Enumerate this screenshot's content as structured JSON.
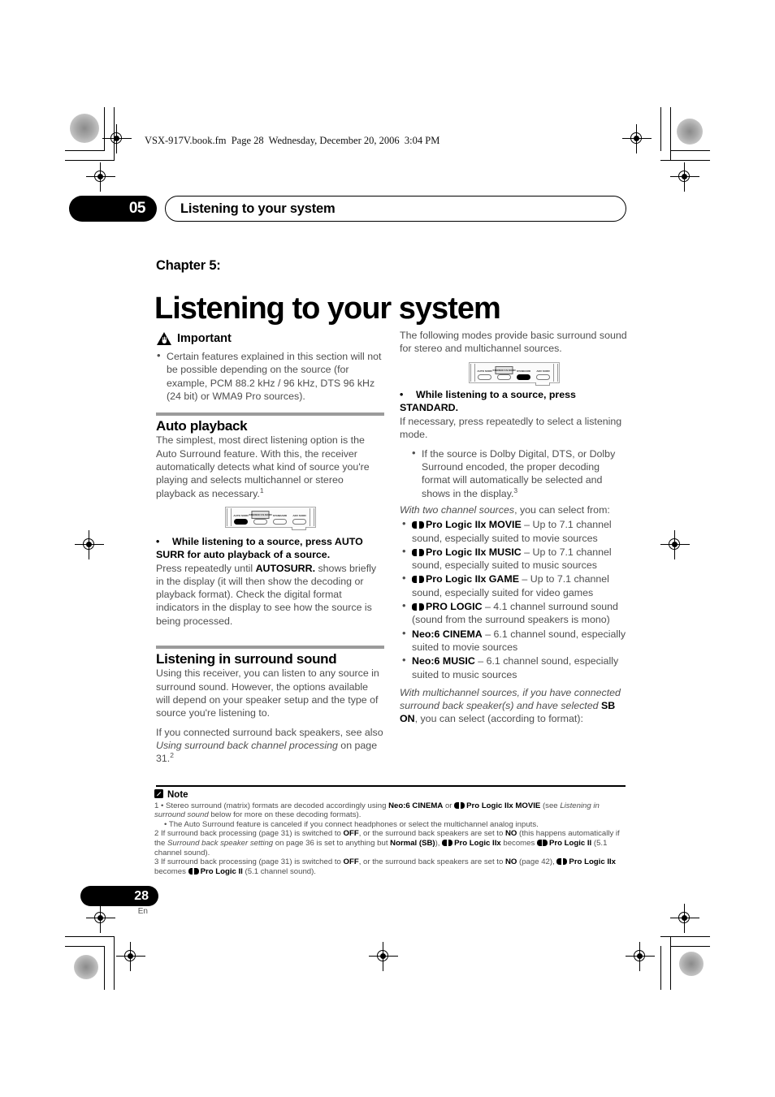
{
  "file_info": "VSX-917V.book.fm  Page 28  Wednesday, December 20, 2006  3:04 PM",
  "running_head": {
    "chapter_number": "05",
    "title": "Listening to your system"
  },
  "chapter": {
    "kicker": "Chapter 5:",
    "title": "Listening to your system"
  },
  "left_column": {
    "important": {
      "heading": "Important",
      "icon": "warning-triangle-icon",
      "bullets": [
        "Certain features explained in this section will not be possible depending on the source (for example, PCM 88.2 kHz / 96 kHz, DTS 96 kHz (24 bit) or WMA9 Pro sources)."
      ]
    },
    "auto_playback": {
      "heading": "Auto playback",
      "body": "The simplest, most direct listening option is the Auto Surround feature. With this, the receiver automatically detects what kind of source you're playing and selects multichannel or stereo playback as necessary.",
      "body_footnote": "1",
      "panel": {
        "name": "receiver-button-panel-auto-surr",
        "buttons": [
          {
            "caption": "AUTO SURR",
            "state": "on"
          },
          {
            "caption": "STEREO/ F.S.SURR",
            "state": "off",
            "boxed": true
          },
          {
            "caption": "STANDARD",
            "state": "off"
          },
          {
            "caption": "ADV SURR",
            "state": "off"
          }
        ]
      },
      "action": "While listening to a source, press AUTO SURR for auto playback of a source.",
      "after_action_pre": "Press repeatedly until ",
      "after_action_bold": "AUTOSURR.",
      "after_action_post": " shows briefly in the display (it will then show the decoding or playback format). Check the digital format indicators in the display to see how the source is being processed."
    },
    "surround_sound": {
      "heading": "Listening in surround sound",
      "para1": "Using this receiver, you can listen to any source in surround sound. However, the options available will depend on your speaker setup and the type of source you're listening to.",
      "para2_pre": "If you connected surround back speakers, see also ",
      "para2_italic": "Using surround back channel processing",
      "para2_post": " on page 31.",
      "para2_footnote": "2"
    }
  },
  "right_column": {
    "intro": "The following modes provide basic surround sound for stereo and multichannel sources.",
    "panel": {
      "name": "receiver-button-panel-standard",
      "buttons": [
        {
          "caption": "AUTO SURR",
          "state": "off"
        },
        {
          "caption": "STEREO/ F.S.SURR",
          "state": "off",
          "boxed": true
        },
        {
          "caption": "STANDARD",
          "state": "on"
        },
        {
          "caption": "ADV SURR",
          "state": "off"
        }
      ]
    },
    "action": "While listening to a source, press STANDARD.",
    "after_action": "If necessary, press repeatedly to select a listening mode.",
    "sub_bullet": "If the source is Dolby Digital, DTS, or Dolby Surround encoded, the proper decoding format will automatically be selected and shows in the display.",
    "sub_bullet_footnote": "3",
    "two_channel_lead_italic": "With two channel sources",
    "two_channel_lead_rest": ", you can select from:",
    "modes": [
      {
        "dolby": true,
        "name": "Pro Logic IIx MOVIE",
        "desc": " – Up to 7.1 channel sound, especially suited to movie sources"
      },
      {
        "dolby": true,
        "name": "Pro Logic IIx MUSIC",
        "desc": " – Up to 7.1 channel sound, especially suited to music sources"
      },
      {
        "dolby": true,
        "name": "Pro Logic IIx GAME",
        "desc": " – Up to 7.1 channel sound, especially suited for video games"
      },
      {
        "dolby": true,
        "name": "PRO LOGIC",
        "desc": " – 4.1 channel surround sound (sound from the surround speakers is mono)"
      },
      {
        "dolby": false,
        "name": "Neo:6 CINEMA",
        "desc": " – 6.1 channel sound, especially suited to movie sources"
      },
      {
        "dolby": false,
        "name": "Neo:6 MUSIC",
        "desc": " – 6.1 channel sound, especially suited to music sources"
      }
    ],
    "multichannel_lead_italic": "With multichannel sources, if you have connected surround back speaker(s) and have selected ",
    "multichannel_bold": "SB ON",
    "multichannel_rest": ", you can select (according to format):"
  },
  "notes": {
    "heading": "Note",
    "icon": "note-pencil-icon",
    "n1_a_pre": "1 • Stereo surround (matrix) formats are decoded accordingly using ",
    "n1_a_bold1": "Neo:6 CINEMA",
    "n1_a_mid": " or ",
    "n1_a_bold2": "Pro Logic IIx MOVIE",
    "n1_a_post": " (see ",
    "n1_a_italic": "Listening in surround sound",
    "n1_a_tail": " below for more on these decoding formats).",
    "n1_b": "• The Auto Surround feature is canceled if you connect headphones or select the multichannel analog inputs.",
    "n2_p1": "2 If surround back processing (page 31) is switched to ",
    "n2_b1": "OFF",
    "n2_p2": ", or the surround back speakers are set to ",
    "n2_b2": "NO",
    "n2_p3": " (this happens automatically if the ",
    "n2_i1": "Surround back speaker setting",
    "n2_p4": " on page 36 is set to anything but ",
    "n2_b3": "Normal (SB)",
    "n2_p5": "), ",
    "n2_b4": "Pro Logic IIx",
    "n2_p6": " becomes ",
    "n2_b5": "Pro Logic II",
    "n2_p7": " (5.1 channel sound).",
    "n3_p1": "3 If surround back processing (page 31) is switched to ",
    "n3_b1": "OFF",
    "n3_p2": ", or the surround back speakers are set to ",
    "n3_b2": "NO",
    "n3_p3": " (page 42), ",
    "n3_b3": "Pro Logic IIx",
    "n3_p4": " becomes ",
    "n3_b4": "Pro Logic II",
    "n3_p5": " (5.1 channel sound)."
  },
  "footer": {
    "page_number": "28",
    "language": "En"
  }
}
